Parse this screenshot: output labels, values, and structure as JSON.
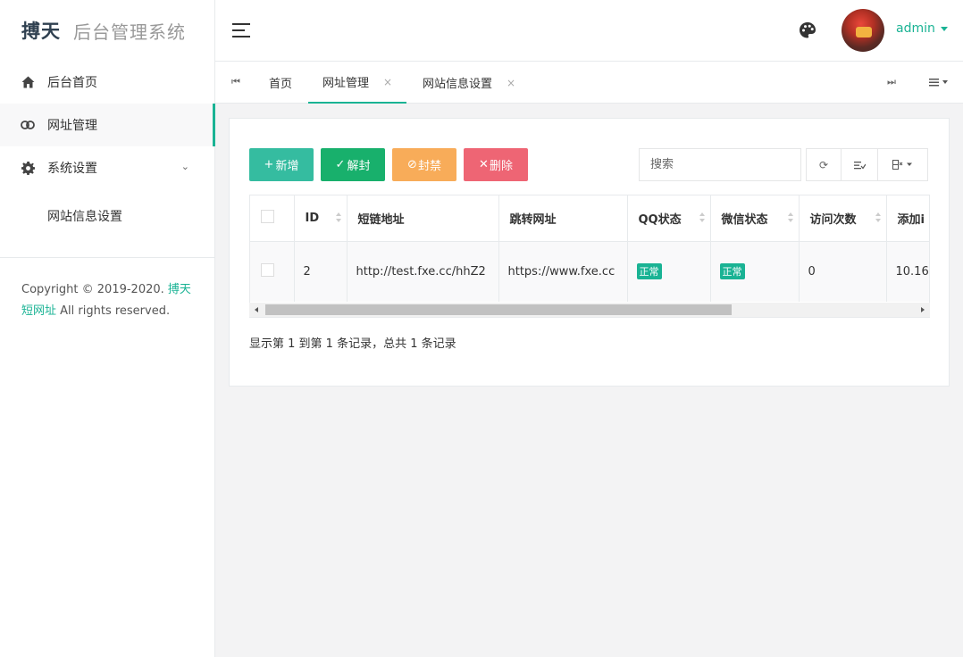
{
  "brand": {
    "name": "搏天",
    "subtitle": "后台管理系统"
  },
  "sidebar": {
    "items": [
      {
        "label": "后台首页",
        "icon": "home-icon"
      },
      {
        "label": "网址管理",
        "icon": "link-icon",
        "active": true
      },
      {
        "label": "系统设置",
        "icon": "gear-icon",
        "expanded": true
      }
    ],
    "sub_items": [
      {
        "label": "网站信息设置"
      }
    ],
    "copyright": {
      "prefix": "Copyright © 2019-2020. ",
      "link": "搏天短网址",
      "suffix": " All rights reserved."
    }
  },
  "header": {
    "user_name": "admin",
    "icons": [
      "menu-toggle-icon",
      "palette-icon"
    ]
  },
  "tabs": [
    {
      "label": "首页",
      "closable": false
    },
    {
      "label": "网址管理",
      "closable": true,
      "active": true
    },
    {
      "label": "网站信息设置",
      "closable": true
    }
  ],
  "tab_close_glyph": "×",
  "toolbar": {
    "add_label": "新增",
    "unban_label": "解封",
    "ban_label": "封禁",
    "delete_label": "删除",
    "search_placeholder": "搜索",
    "colors": {
      "add": "#1ab394",
      "unban": "#18b06c",
      "ban": "#f8ac59",
      "delete": "#ed5565"
    }
  },
  "table": {
    "columns": [
      "ID",
      "短链地址",
      "跳转网址",
      "QQ状态",
      "微信状态",
      "访问次数",
      "添加i"
    ],
    "rows": [
      {
        "id": "2",
        "short_url": "http://test.fxe.cc/hhZ2",
        "target_url": "https://www.fxe.cc",
        "qq_status": "正常",
        "wechat_status": "正常",
        "visits": "0",
        "added": "10.16"
      }
    ]
  },
  "pager": {
    "info": "显示第 1 到第 1 条记录，总共 1 条记录"
  },
  "accent_color": "#1ab394"
}
